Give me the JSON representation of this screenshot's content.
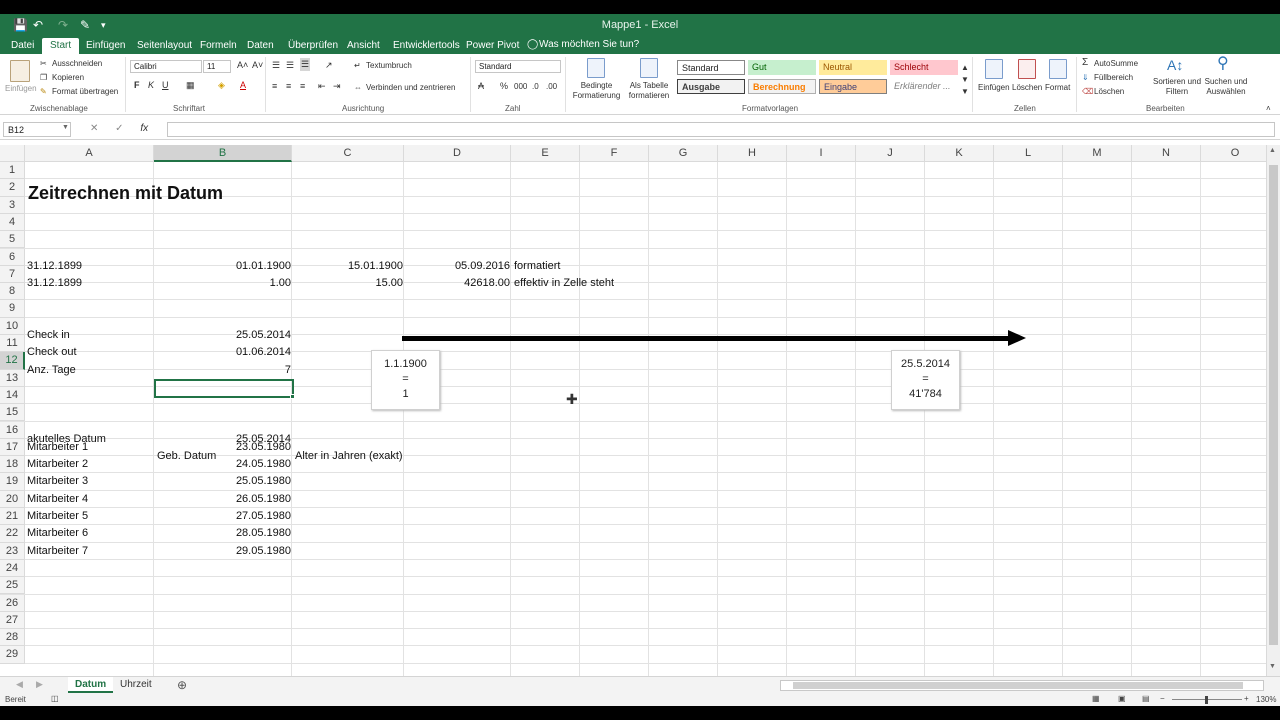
{
  "window": {
    "title": "Mappe1 - Excel"
  },
  "tabs": [
    "Datei",
    "Start",
    "Einfügen",
    "Seitenlayout",
    "Formeln",
    "Daten",
    "Überprüfen",
    "Ansicht",
    "Entwicklertools",
    "Power Pivot"
  ],
  "active_tab": "Start",
  "tell_me": "Was möchten Sie tun?",
  "ribbon": {
    "clipboard": {
      "paste": "Einfügen",
      "cut": "Ausschneiden",
      "copy": "Kopieren",
      "format_painter": "Format übertragen",
      "group": "Zwischenablage"
    },
    "font": {
      "name": "Calibri",
      "size": "11",
      "bold": "F",
      "italic": "K",
      "underline": "U",
      "group": "Schriftart"
    },
    "alignment": {
      "wrap": "Textumbruch",
      "merge": "Verbinden und zentrieren",
      "group": "Ausrichtung"
    },
    "number": {
      "format": "Standard",
      "group": "Zahl"
    },
    "styles": {
      "conditional": "Bedingte\nFormatierung",
      "table": "Als Tabelle\nformatieren",
      "cells": [
        {
          "label": "Standard",
          "bg": "#ffffff",
          "color": "#000000"
        },
        {
          "label": "Gut",
          "bg": "#c6efce",
          "color": "#006100"
        },
        {
          "label": "Neutral",
          "bg": "#ffeb9c",
          "color": "#9c5700"
        },
        {
          "label": "Schlecht",
          "bg": "#ffc7ce",
          "color": "#9c0006"
        },
        {
          "label": "Ausgabe",
          "bg": "#f2f2f2",
          "color": "#3f3f3f"
        },
        {
          "label": "Berechnung",
          "bg": "#f2f2f2",
          "color": "#fa7d00"
        },
        {
          "label": "Eingabe",
          "bg": "#ffcc99",
          "color": "#3f3f76"
        },
        {
          "label": "Erklärender ...",
          "bg": "#ffffff",
          "color": "#7f7f7f"
        }
      ],
      "group": "Formatvorlagen"
    },
    "cells": {
      "insert": "Einfügen",
      "delete": "Löschen",
      "format": "Format",
      "group": "Zellen"
    },
    "editing": {
      "autosum": "AutoSumme",
      "fill": "Füllbereich",
      "clear": "Löschen",
      "sort": "Sortieren und\nFiltern",
      "find": "Suchen und\nAuswählen",
      "group": "Bearbeiten"
    }
  },
  "namebox": "B12",
  "formula": "",
  "columns": [
    "A",
    "B",
    "C",
    "D",
    "E",
    "F",
    "G",
    "H",
    "I",
    "J",
    "K",
    "L",
    "M",
    "N",
    "O"
  ],
  "selected_column": "B",
  "rows": [
    "1",
    "2",
    "3",
    "4",
    "5",
    "6",
    "7",
    "8",
    "9",
    "10",
    "11",
    "12",
    "13",
    "14",
    "15",
    "16",
    "17",
    "18",
    "19",
    "20",
    "21",
    "22",
    "23",
    "24",
    "25",
    "26",
    "27",
    "28",
    "29"
  ],
  "selected_row": "12",
  "sheet": {
    "title": "Zeitrechnen mit Datum",
    "r5": {
      "A": "31.12.1899",
      "B": "01.01.1900",
      "C": "15.01.1900",
      "D": "05.09.2016",
      "E": "formatiert"
    },
    "r6": {
      "A": "31.12.1899",
      "B": "1.00",
      "C": "15.00",
      "D": "42618.00",
      "E": "effektiv in Zelle steht"
    },
    "r9": {
      "A": "Check in",
      "B": "25.05.2014"
    },
    "r10": {
      "A": "Check out",
      "B": "01.06.2014"
    },
    "r11": {
      "A": "Anz. Tage",
      "B": "7"
    },
    "r15": {
      "A": "akutelles Datum",
      "B": "25.05.2014"
    },
    "r16": {
      "B": "Geb. Datum",
      "C": "Alter in Jahren (exakt)"
    },
    "employees": [
      {
        "name": "Mitarbeiter 1",
        "date": "23.05.1980"
      },
      {
        "name": "Mitarbeiter 2",
        "date": "24.05.1980"
      },
      {
        "name": "Mitarbeiter 3",
        "date": "25.05.1980"
      },
      {
        "name": "Mitarbeiter 4",
        "date": "26.05.1980"
      },
      {
        "name": "Mitarbeiter 5",
        "date": "27.05.1980"
      },
      {
        "name": "Mitarbeiter 6",
        "date": "28.05.1980"
      },
      {
        "name": "Mitarbeiter 7",
        "date": "29.05.1980"
      }
    ],
    "box1": {
      "l1": "1.1.1900",
      "l2": "=",
      "l3": "1"
    },
    "box2": {
      "l1": "25.5.2014",
      "l2": "=",
      "l3": "41'784"
    }
  },
  "sheet_tabs": [
    "Datum",
    "Uhrzeit"
  ],
  "active_sheet": "Datum",
  "status": {
    "ready": "Bereit",
    "zoom": "130%"
  },
  "colors": {
    "accent": "#217346",
    "select": "#217346"
  }
}
